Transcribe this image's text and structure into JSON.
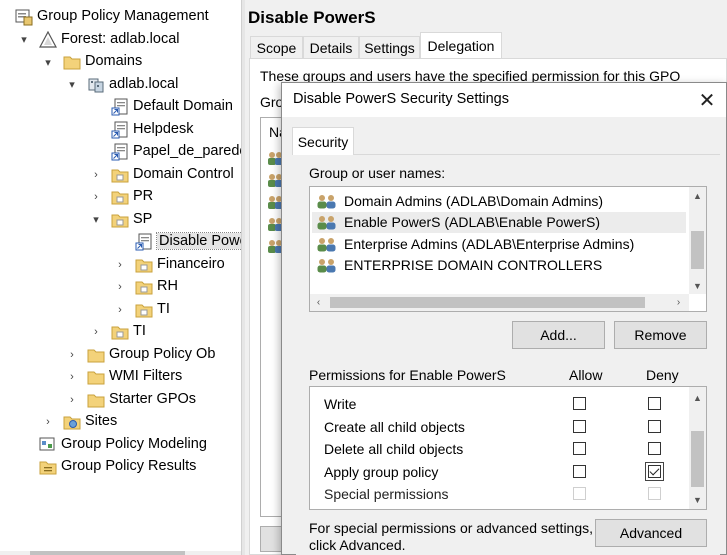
{
  "tree": {
    "items": [
      {
        "label": "Group Policy Management",
        "icon": "gpm-console-icon",
        "expander": "",
        "state": ""
      },
      {
        "label": "Forest: adlab.local",
        "icon": "forest-icon",
        "expander": "▾",
        "state": "expanded"
      },
      {
        "label": "Domains",
        "icon": "folder-icon",
        "expander": "▾",
        "state": "expanded"
      },
      {
        "label": "adlab.local",
        "icon": "domain-icon",
        "expander": "▾",
        "state": "expanded"
      },
      {
        "label": "Default Domain",
        "icon": "gpo-link-icon",
        "expander": "",
        "state": ""
      },
      {
        "label": "Helpdesk",
        "icon": "gpo-link-icon",
        "expander": "",
        "state": ""
      },
      {
        "label": "Papel_de_parede",
        "icon": "gpo-link-icon",
        "expander": "",
        "state": ""
      },
      {
        "label": "Domain Control",
        "icon": "ou-folder-icon",
        "expander": "›",
        "state": "collapsed"
      },
      {
        "label": "PR",
        "icon": "ou-folder-icon",
        "expander": "›",
        "state": "collapsed"
      },
      {
        "label": "SP",
        "icon": "ou-folder-icon",
        "expander": "▾",
        "state": "expanded"
      },
      {
        "label": "Disable Powe",
        "icon": "gpo-link-icon",
        "expander": "",
        "state": "selected"
      },
      {
        "label": "Financeiro",
        "icon": "ou-folder-icon",
        "expander": "›",
        "state": "collapsed"
      },
      {
        "label": "RH",
        "icon": "ou-folder-icon",
        "expander": "›",
        "state": "collapsed"
      },
      {
        "label": "TI",
        "icon": "ou-folder-icon",
        "expander": "›",
        "state": "collapsed"
      },
      {
        "label": "TI",
        "icon": "ou-folder-icon",
        "expander": "›",
        "state": "collapsed"
      },
      {
        "label": "Group Policy Ob",
        "icon": "folder-icon",
        "expander": "›",
        "state": "collapsed"
      },
      {
        "label": "WMI Filters",
        "icon": "folder-icon",
        "expander": "›",
        "state": "collapsed"
      },
      {
        "label": "Starter GPOs",
        "icon": "folder-icon",
        "expander": "›",
        "state": "collapsed"
      },
      {
        "label": "Sites",
        "icon": "sites-icon",
        "expander": "›",
        "state": "collapsed"
      },
      {
        "label": "Group Policy Modeling",
        "icon": "modeling-icon",
        "expander": "",
        "state": ""
      },
      {
        "label": "Group Policy Results",
        "icon": "results-icon",
        "expander": "",
        "state": ""
      }
    ]
  },
  "gpo": {
    "title": "Disable PowerS",
    "tabs": [
      "Scope",
      "Details",
      "Settings",
      "Delegation"
    ],
    "active_tab": "Delegation",
    "description": "These groups and users have the specified permission for this GPO",
    "groups_label": "Grou",
    "column_header": "Na"
  },
  "dialog": {
    "title": "Disable PowerS Security Settings",
    "close": "✕",
    "tab": "Security",
    "names_label": "Group or user names:",
    "principals": [
      {
        "name": "Domain Admins (ADLAB\\Domain Admins)",
        "selected": false
      },
      {
        "name": "Enable PowerS (ADLAB\\Enable PowerS)",
        "selected": true
      },
      {
        "name": "Enterprise Admins (ADLAB\\Enterprise Admins)",
        "selected": false
      },
      {
        "name": "ENTERPRISE DOMAIN CONTROLLERS",
        "selected": false
      }
    ],
    "add_button": "Add...",
    "remove_button": "Remove",
    "permissions_label": "Permissions for Enable PowerS",
    "allow_header": "Allow",
    "deny_header": "Deny",
    "permissions": [
      {
        "name": "Write",
        "allow": false,
        "deny": false,
        "enabled": true
      },
      {
        "name": "Create all child objects",
        "allow": false,
        "deny": false,
        "enabled": true
      },
      {
        "name": "Delete all child objects",
        "allow": false,
        "deny": false,
        "enabled": true
      },
      {
        "name": "Apply group policy",
        "allow": false,
        "deny": true,
        "enabled": true
      },
      {
        "name": "Special permissions",
        "allow": false,
        "deny": false,
        "enabled": false
      }
    ],
    "advanced_text_1": "For special permissions or advanced settings,",
    "advanced_text_2": "click Advanced.",
    "advanced_button": "Advanced"
  }
}
